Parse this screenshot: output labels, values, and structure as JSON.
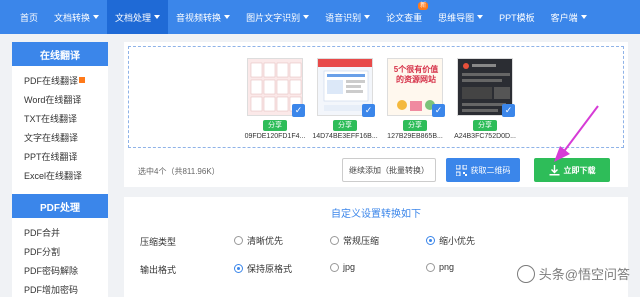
{
  "nav": {
    "items": [
      {
        "label": "首页",
        "caret": false
      },
      {
        "label": "文档转换",
        "caret": true
      },
      {
        "label": "文档处理",
        "caret": true,
        "active": true
      },
      {
        "label": "音视频转换",
        "caret": true
      },
      {
        "label": "图片文字识别",
        "caret": true
      },
      {
        "label": "语音识别",
        "caret": true
      },
      {
        "label": "论文查重",
        "caret": false,
        "badge": "hot"
      },
      {
        "label": "思维导图",
        "caret": true
      },
      {
        "label": "PPT模板",
        "caret": false
      },
      {
        "label": "客户端",
        "caret": true
      }
    ],
    "hot_badge": "新"
  },
  "sidebar": {
    "section1_title": "在线翻译",
    "section1_items": [
      "PDF在线翻译",
      "Word在线翻译",
      "TXT在线翻译",
      "文字在线翻译",
      "PPT在线翻译",
      "Excel在线翻译"
    ],
    "section2_title": "PDF处理",
    "section2_items": [
      "PDF合并",
      "PDF分割",
      "PDF密码解除",
      "PDF增加密码"
    ]
  },
  "files": [
    {
      "name": "09FDE120FD1F4...",
      "share": "分享",
      "thumb_text": ""
    },
    {
      "name": "14D74BE3EFF16B...",
      "share": "分享",
      "thumb_text": ""
    },
    {
      "name": "127B29EB865B...",
      "share": "分享",
      "thumb_text": "5个很有价值的资源网站"
    },
    {
      "name": "A24B3FC752D0D...",
      "share": "分享",
      "thumb_text": ""
    }
  ],
  "actions": {
    "selected_info": "选中4个（共811.96K）",
    "add_label": "继续添加（批量转换）",
    "qr_label": "获取二维码",
    "download_label": "立即下载"
  },
  "settings": {
    "title": "自定义设置转换如下",
    "compress_label": "压缩类型",
    "compress_options": [
      "清晰优先",
      "常规压缩",
      "缩小优先"
    ],
    "compress_selected": "缩小优先",
    "format_label": "输出格式",
    "format_options": [
      "保持原格式",
      "jpg",
      "png"
    ],
    "format_selected": "保持原格式"
  },
  "watermark": "头条@悟空问答",
  "colors": {
    "primary": "#3b86ea",
    "success": "#2ebd59",
    "accent": "#ff7a1a",
    "arrow": "#d63bd6"
  }
}
